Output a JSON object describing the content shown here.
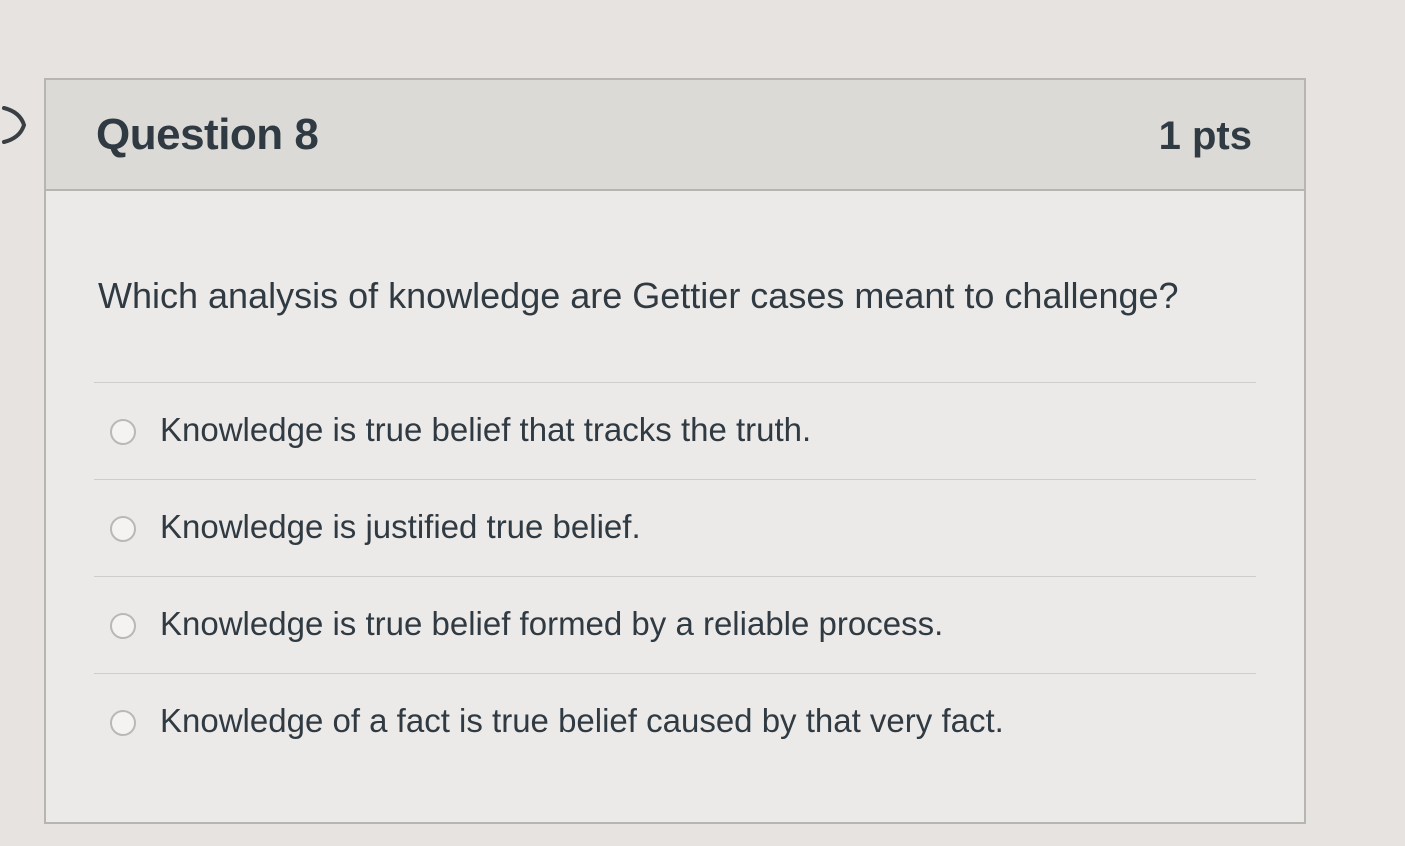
{
  "question": {
    "title": "Question 8",
    "points": "1 pts",
    "text": "Which analysis of knowledge are Gettier cases meant to challenge?"
  },
  "answers": [
    {
      "label": "Knowledge is true belief that tracks the truth.",
      "selected": false
    },
    {
      "label": "Knowledge is justified true belief.",
      "selected": false
    },
    {
      "label": "Knowledge is true belief formed by a reliable process.",
      "selected": false
    },
    {
      "label": "Knowledge of a fact is true belief caused by that very fact.",
      "selected": false
    }
  ],
  "icons": {
    "nav": "chevron-right-icon",
    "answer_control": "radio-button-icon"
  },
  "colors": {
    "background": "#e6e3e0",
    "header": "#dcdad7",
    "text": "#2f3a42",
    "border": "#b7b5b2"
  }
}
